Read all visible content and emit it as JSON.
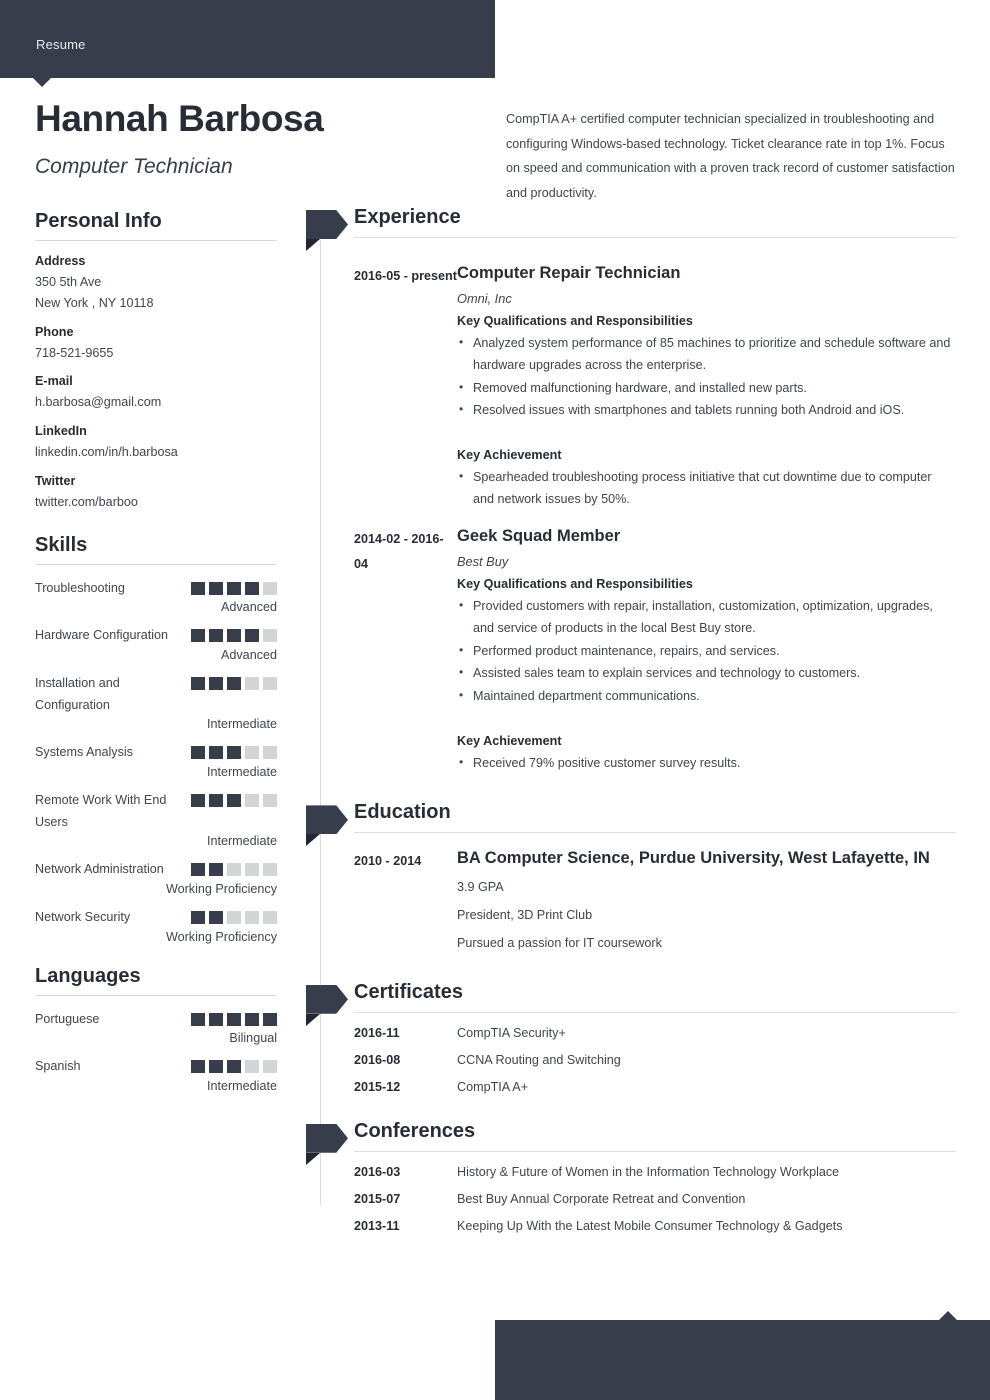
{
  "topbar": {
    "label": "Resume"
  },
  "header": {
    "name": "Hannah Barbosa",
    "job_title": "Computer Technician",
    "summary": "CompTIA A+ certified computer technician specialized in troubleshooting and configuring Windows-based technology. Ticket clearance rate in top 1%. Focus on speed and communication with a proven track record of customer satisfaction and productivity."
  },
  "colors": {
    "dark": "#373d4a",
    "fold": "#222733",
    "dot_on": "#373d4a",
    "dot_off": "#d2d4d6",
    "text": "#3f454e"
  },
  "personal_info": {
    "title": "Personal Info",
    "items": [
      {
        "label": "Address",
        "value": "350 5th Ave\nNew York , NY 10118",
        "line1": "350 5th Ave",
        "line2": "New York , NY 10118"
      },
      {
        "label": "Phone",
        "value": "718-521-9655"
      },
      {
        "label": "E-mail",
        "value": "h.barbosa@gmail.com"
      },
      {
        "label": "LinkedIn",
        "value": "linkedin.com/in/h.barbosa"
      },
      {
        "label": "Twitter",
        "value": "twitter.com/barboo"
      }
    ]
  },
  "skills": {
    "title": "Skills",
    "max": 5,
    "items": [
      {
        "name": "Troubleshooting",
        "rating": 4,
        "level": "Advanced"
      },
      {
        "name": "Hardware Configuration",
        "rating": 4,
        "level": "Advanced"
      },
      {
        "name": "Installation and Configuration",
        "rating": 3,
        "level": "Intermediate"
      },
      {
        "name": "Systems Analysis",
        "rating": 3,
        "level": "Intermediate"
      },
      {
        "name": "Remote Work With End Users",
        "rating": 3,
        "level": "Intermediate"
      },
      {
        "name": "Network Administration",
        "rating": 2,
        "level": "Working Proficiency"
      },
      {
        "name": "Network Security",
        "rating": 2,
        "level": "Working Proficiency"
      }
    ]
  },
  "languages": {
    "title": "Languages",
    "max": 5,
    "items": [
      {
        "name": "Portuguese",
        "rating": 5,
        "level": "Bilingual"
      },
      {
        "name": "Spanish",
        "rating": 3,
        "level": "Intermediate"
      }
    ]
  },
  "experience": {
    "title": "Experience",
    "entries": [
      {
        "date": "2016-05 - present",
        "title": "Computer Repair Technician",
        "org": "Omni, Inc",
        "quals_heading": "Key Qualifications and Responsibilities",
        "bullets": [
          "Analyzed system performance of 85 machines to prioritize and schedule software and hardware upgrades across the enterprise.",
          "Removed malfunctioning hardware, and installed new parts.",
          "Resolved issues with smartphones and tablets running both Android and iOS."
        ],
        "achievement_heading": "Key Achievement",
        "achievements": [
          "Spearheaded troubleshooting process initiative that cut downtime due to computer and network issues by 50%."
        ]
      },
      {
        "date": "2014-02 - 2016-04",
        "title": "Geek Squad Member",
        "org": "Best Buy",
        "quals_heading": "Key Qualifications and Responsibilities",
        "bullets": [
          "Provided customers with repair, installation, customization, optimization, upgrades, and service of products in the local Best Buy store.",
          "Performed product maintenance, repairs, and services.",
          "Assisted sales team to explain services and technology to customers.",
          "Maintained department communications."
        ],
        "achievement_heading": "Key Achievement",
        "achievements": [
          "Received 79% positive customer survey results."
        ]
      }
    ]
  },
  "education": {
    "title": "Education",
    "entries": [
      {
        "date": "2010 - 2014",
        "title": "BA Computer Science, Purdue University, West Lafayette, IN",
        "lines": [
          "3.9 GPA",
          "President, 3D Print Club",
          "Pursued a passion for IT coursework"
        ]
      }
    ]
  },
  "certificates": {
    "title": "Certificates",
    "rows": [
      {
        "date": "2016-11",
        "text": "CompTIA Security+"
      },
      {
        "date": "2016-08",
        "text": "CCNA Routing and Switching"
      },
      {
        "date": "2015-12",
        "text": "CompTIA A+"
      }
    ]
  },
  "conferences": {
    "title": "Conferences",
    "rows": [
      {
        "date": "2016-03",
        "text": "History & Future of Women in the Information Technology Workplace"
      },
      {
        "date": "2015-07",
        "text": "Best Buy Annual Corporate Retreat and Convention"
      },
      {
        "date": "2013-11",
        "text": "Keeping Up With the Latest Mobile Consumer Technology & Gadgets"
      }
    ]
  }
}
